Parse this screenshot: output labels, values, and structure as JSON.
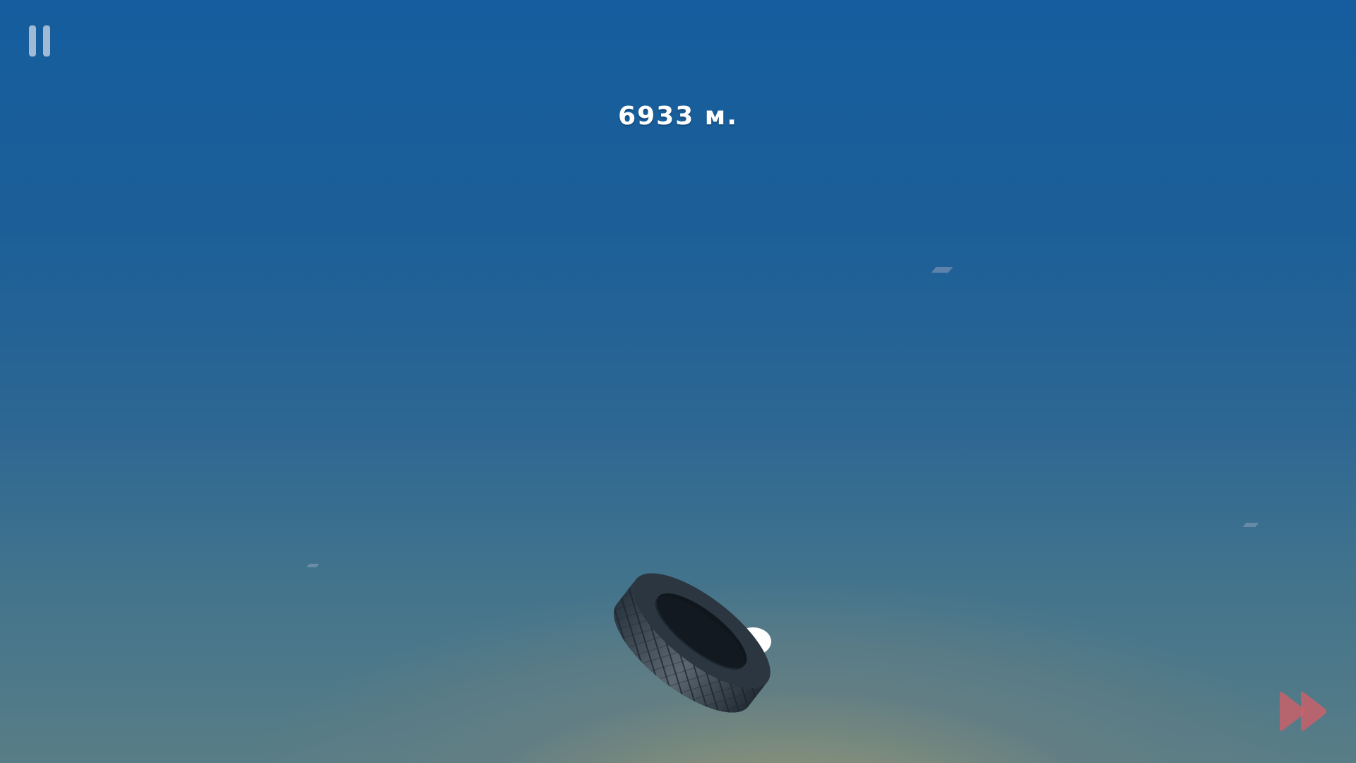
{
  "hud": {
    "distance": "6933 м."
  },
  "icons": {
    "pause": "pause-icon",
    "skip": "fast-forward-icon"
  },
  "colors": {
    "sky_top": "#155d9e",
    "sky_bottom": "#587d86",
    "horizon_glow": "#a7a682",
    "skip_button": "#c8626b",
    "pause_button": "#d6deec"
  }
}
